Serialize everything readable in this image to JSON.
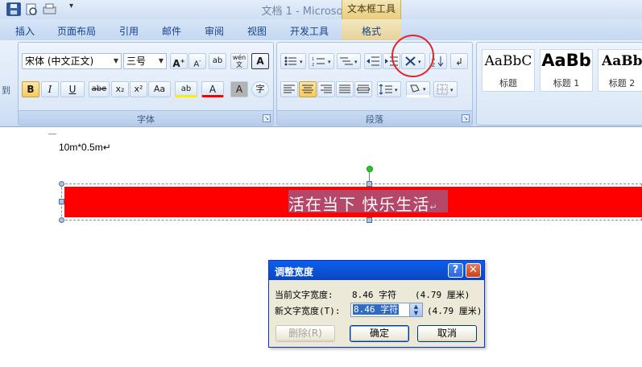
{
  "window": {
    "title": "文档 1 - Microsoft Word",
    "context_tab_header": "文本框工具"
  },
  "quick_access": {
    "save_icon": "save-icon",
    "print_preview_icon": "print-preview-icon",
    "print_icon": "print-icon",
    "customize_arrow": "▾"
  },
  "tabs": [
    {
      "label": "插入"
    },
    {
      "label": "页面布局"
    },
    {
      "label": "引用"
    },
    {
      "label": "邮件"
    },
    {
      "label": "审阅"
    },
    {
      "label": "视图"
    },
    {
      "label": "开发工具"
    },
    {
      "label": "格式"
    }
  ],
  "ribbon": {
    "left_cut_label": "到",
    "font_group": {
      "label": "字体",
      "font_name": "宋体 (中文正文)",
      "font_size": "三号",
      "grow_font": "A",
      "shrink_font": "A",
      "clear_format": "ab",
      "phonetic": "wén",
      "char_border": "A",
      "bold": "B",
      "italic": "I",
      "underline": "U",
      "strike": "abe",
      "subscript": "x₂",
      "superscript": "x²",
      "change_case": "Aa",
      "highlight": "ab",
      "font_color": "A",
      "char_shading": "A",
      "enclose": "字"
    },
    "paragraph_group": {
      "label": "段落"
    },
    "styles_group": {
      "styles": [
        {
          "preview": "AaBbC",
          "name": "标题"
        },
        {
          "preview": "AaBb",
          "name": "标题 1"
        },
        {
          "preview": "AaBb",
          "name": "标题 2"
        }
      ]
    }
  },
  "document": {
    "line1": "10m*0.5m↵",
    "textbox_text": "活在当下    快乐生活",
    "textbox_mark": "↵",
    "textbox_color": "#ff0000"
  },
  "dialog": {
    "title": "调整宽度",
    "help": "?",
    "close": "✕",
    "current_label": "当前文字宽度:",
    "current_value": "8.46 字符",
    "current_cm": "(4.79 厘米)",
    "new_label": "新文字宽度(T):",
    "new_value": "8.46 字符",
    "new_cm": "(4.79 厘米)",
    "delete_btn": "删除(R)",
    "ok_btn": "确定",
    "cancel_btn": "取消"
  }
}
